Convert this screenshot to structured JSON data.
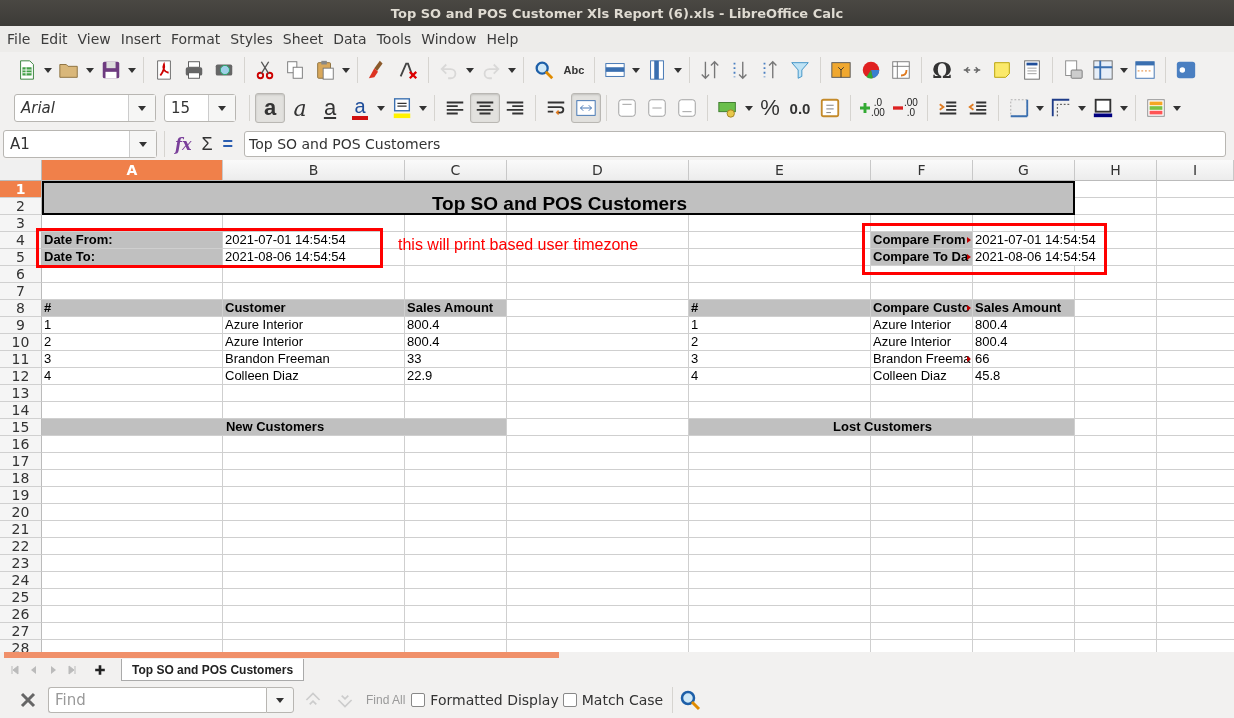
{
  "window": {
    "title": "Top SO and POS Customer Xls Report (6).xls - LibreOffice Calc"
  },
  "menu": [
    "File",
    "Edit",
    "View",
    "Insert",
    "Format",
    "Styles",
    "Sheet",
    "Data",
    "Tools",
    "Window",
    "Help"
  ],
  "standard_toolbar": [
    {
      "kind": "new",
      "disabled": false
    },
    {
      "kind": "open",
      "disabled": false
    },
    {
      "kind": "save",
      "disabled": false
    },
    {
      "kind": "pdf",
      "disabled": false
    },
    {
      "kind": "print",
      "disabled": false
    },
    {
      "kind": "preview",
      "disabled": false
    },
    {
      "kind": "cut",
      "disabled": false
    },
    {
      "kind": "copy",
      "disabled": false
    },
    {
      "kind": "paste",
      "disabled": false
    },
    {
      "kind": "clone",
      "disabled": false
    },
    {
      "kind": "clear",
      "disabled": false
    },
    {
      "kind": "undo",
      "disabled": true
    },
    {
      "kind": "redo",
      "disabled": true
    },
    {
      "kind": "find",
      "disabled": false
    },
    {
      "kind": "spelling",
      "label": "Abc",
      "disabled": false
    },
    {
      "kind": "rows",
      "disabled": false
    },
    {
      "kind": "cols",
      "disabled": false
    },
    {
      "kind": "sort",
      "disabled": false
    },
    {
      "kind": "sort-asc",
      "disabled": false
    },
    {
      "kind": "sort-desc",
      "disabled": false
    },
    {
      "kind": "filter",
      "disabled": false
    },
    {
      "kind": "image",
      "disabled": false
    },
    {
      "kind": "chart",
      "disabled": false
    },
    {
      "kind": "pivot",
      "disabled": false
    },
    {
      "kind": "special",
      "label": "Ω",
      "disabled": false
    },
    {
      "kind": "link",
      "disabled": false
    },
    {
      "kind": "comment",
      "disabled": false
    },
    {
      "kind": "headerfooter",
      "disabled": false
    },
    {
      "kind": "printrange",
      "disabled": false
    },
    {
      "kind": "freeze",
      "disabled": false
    },
    {
      "kind": "split",
      "disabled": false
    },
    {
      "kind": "more",
      "disabled": false
    }
  ],
  "formatting_toolbar": {
    "font_name": "Arial",
    "font_size": "15",
    "buttons": [
      {
        "kind": "bold",
        "label": "a",
        "pressed": true
      },
      {
        "kind": "italic",
        "label": "a",
        "pressed": false
      },
      {
        "kind": "underline",
        "label": "a",
        "pressed": false
      },
      {
        "kind": "font-color",
        "label": "a",
        "pressed": false
      },
      {
        "kind": "highlight",
        "pressed": false
      },
      {
        "kind": "align-left",
        "pressed": false
      },
      {
        "kind": "align-center",
        "pressed": true
      },
      {
        "kind": "align-right",
        "pressed": false
      },
      {
        "kind": "wrap",
        "pressed": false
      },
      {
        "kind": "merge",
        "pressed": true
      },
      {
        "kind": "valign-top",
        "pressed": false
      },
      {
        "kind": "valign-center",
        "pressed": false
      },
      {
        "kind": "valign-bottom",
        "pressed": false
      },
      {
        "kind": "currency",
        "pressed": false
      },
      {
        "kind": "percent",
        "label": "%",
        "pressed": false
      },
      {
        "kind": "number",
        "label": "0.0",
        "pressed": false
      },
      {
        "kind": "date",
        "pressed": false
      },
      {
        "kind": "add-decimal",
        "labels": [
          ".0",
          ".00"
        ],
        "pressed": false
      },
      {
        "kind": "del-decimal",
        "labels": [
          ".00",
          ".0"
        ],
        "pressed": false
      },
      {
        "kind": "indent",
        "pressed": false
      },
      {
        "kind": "outdent",
        "pressed": false
      },
      {
        "kind": "borders",
        "pressed": false
      },
      {
        "kind": "border-style",
        "pressed": false
      },
      {
        "kind": "border-color",
        "pressed": false
      },
      {
        "kind": "conditional",
        "pressed": false
      }
    ]
  },
  "formula_bar": {
    "cell_ref": "A1",
    "buttons": [
      {
        "kind": "function-wizard",
        "label": "fx"
      },
      {
        "kind": "sum",
        "label": "Σ"
      },
      {
        "kind": "formula",
        "label": "="
      }
    ],
    "content": "Top SO and POS Customers"
  },
  "sheet": {
    "columns": [
      {
        "label": "A",
        "selected": true
      },
      {
        "label": "B",
        "selected": false
      },
      {
        "label": "C",
        "selected": false
      },
      {
        "label": "D",
        "selected": false
      },
      {
        "label": "E",
        "selected": false
      },
      {
        "label": "F",
        "selected": false
      },
      {
        "label": "G",
        "selected": false
      },
      {
        "label": "H",
        "selected": false
      },
      {
        "label": "I",
        "selected": false
      }
    ],
    "rows": [
      {
        "number": "1",
        "selected": true
      },
      {
        "number": "2",
        "selected": false
      },
      {
        "number": "3",
        "selected": false
      },
      {
        "number": "4",
        "selected": false
      },
      {
        "number": "5",
        "selected": false
      },
      {
        "number": "6",
        "selected": false
      },
      {
        "number": "7",
        "selected": false
      },
      {
        "number": "8",
        "selected": false
      },
      {
        "number": "9",
        "selected": false
      },
      {
        "number": "10",
        "selected": false
      },
      {
        "number": "11",
        "selected": false
      },
      {
        "number": "12",
        "selected": false
      },
      {
        "number": "13",
        "selected": false
      },
      {
        "number": "14",
        "selected": false
      },
      {
        "number": "15",
        "selected": false
      },
      {
        "number": "16",
        "selected": false
      },
      {
        "number": "17",
        "selected": false
      },
      {
        "number": "18",
        "selected": false
      },
      {
        "number": "19",
        "selected": false
      },
      {
        "number": "20",
        "selected": false
      },
      {
        "number": "21",
        "selected": false
      },
      {
        "number": "22",
        "selected": false
      },
      {
        "number": "23",
        "selected": false
      },
      {
        "number": "24",
        "selected": false
      },
      {
        "number": "25",
        "selected": false
      },
      {
        "number": "26",
        "selected": false
      },
      {
        "number": "27",
        "selected": false
      },
      {
        "number": "28",
        "selected": false
      }
    ],
    "title": "Top SO and POS Customers",
    "date_range": [
      {
        "label": "Date From:",
        "value": "2021-07-01 14:54:54"
      },
      {
        "label": "Date To:",
        "value": "2021-08-06 14:54:54"
      }
    ],
    "compare_range": [
      {
        "label": "Compare From",
        "clipped": true,
        "value": "2021-07-01 14:54:54"
      },
      {
        "label": "Compare To Da",
        "clipped": true,
        "value": "2021-08-06 14:54:54"
      }
    ],
    "annotation": "this will print based user timezone",
    "table": {
      "columns": [
        "#",
        "Customer",
        "Sales Amount"
      ],
      "rows": [
        [
          "1",
          "Azure Interior",
          "800.4"
        ],
        [
          "2",
          "Azure Interior",
          "800.4"
        ],
        [
          "3",
          "Brandon Freeman",
          "33"
        ],
        [
          "4",
          "Colleen Diaz",
          "22.9"
        ]
      ]
    },
    "compare_table": {
      "columns": [
        {
          "text": "#",
          "clipped": false
        },
        {
          "text": "Compare Custo",
          "clipped": true
        },
        {
          "text": "Sales Amount",
          "clipped": false
        }
      ],
      "rows": [
        [
          {
            "text": "1",
            "clipped": false
          },
          {
            "text": "Azure Interior",
            "clipped": false
          },
          {
            "text": "800.4",
            "clipped": false
          }
        ],
        [
          {
            "text": "2",
            "clipped": false
          },
          {
            "text": "Azure Interior",
            "clipped": false
          },
          {
            "text": "800.4",
            "clipped": false
          }
        ],
        [
          {
            "text": "3",
            "clipped": false
          },
          {
            "text": "Brandon Freema",
            "clipped": true
          },
          {
            "text": "66",
            "clipped": false
          }
        ],
        [
          {
            "text": "4",
            "clipped": false
          },
          {
            "text": "Colleen Diaz",
            "clipped": false
          },
          {
            "text": "45.8",
            "clipped": false
          }
        ]
      ]
    },
    "new_customers_heading": "New Customers",
    "lost_customers_heading": "Lost Customers"
  },
  "sheet_tabs": [
    {
      "label": "Top SO and POS Customers",
      "selected": true
    }
  ],
  "find_bar": {
    "placeholder": "Find",
    "find_all": "Find All",
    "options": [
      {
        "label": "Formatted Display",
        "checked": false
      },
      {
        "label": "Match Case",
        "checked": false
      }
    ]
  }
}
